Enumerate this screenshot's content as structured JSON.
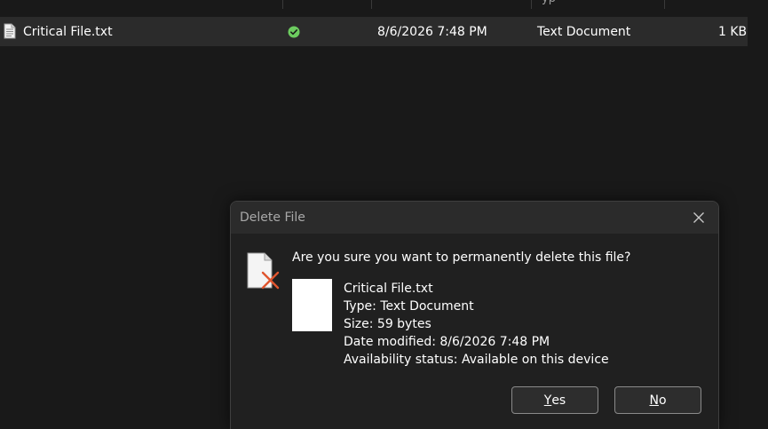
{
  "explorer": {
    "header_partial": "yp",
    "row": {
      "name": "Critical File.txt",
      "status_icon": "green-checkmark-icon",
      "date_modified": "8/6/2026 7:48 PM",
      "type": "Text Document",
      "size": "1 KB"
    }
  },
  "dialog": {
    "title": "Delete File",
    "question": "Are you sure you want to permanently delete this file?",
    "file_name": "Critical File.txt",
    "type_line": "Type: Text Document",
    "size_line": "Size: 59 bytes",
    "date_line": "Date modified: 8/6/2026 7:48 PM",
    "availability_line": "Availability status: Available on this device",
    "yes_mnemonic": "Y",
    "yes_rest": "es",
    "no_mnemonic": "N",
    "no_rest": "o"
  },
  "colors": {
    "background": "#191919",
    "row_highlight": "#2b2b2b",
    "status_green": "#6ccb5f",
    "delete_x": "#e0552e"
  }
}
